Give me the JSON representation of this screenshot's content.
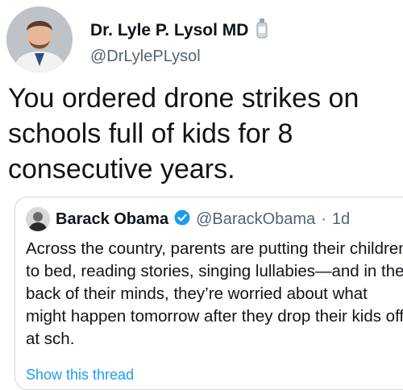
{
  "author": {
    "name": "Dr. Lyle P. Lysol MD",
    "handle": "@DrLylePLysol",
    "badge_icon": "bottle-icon"
  },
  "tweet": {
    "text": "You ordered drone strikes on schools full of kids for 8 consecutive years."
  },
  "quoted_tweet": {
    "name": "Barack Obama",
    "handle": "@BarackObama",
    "separator": "·",
    "time": "1d",
    "verified_icon": "verified-badge-icon",
    "text": "Across the country, parents are putting their children to bed, reading stories, singing lullabies—and in the back of their minds, they’re worried about what might happen tomorrow after they drop their kids off at sch.",
    "show_thread": "Show this thread"
  },
  "colors": {
    "text": "#0f1419",
    "secondary": "#536471",
    "link": "#1d9bf0",
    "verified": "#1d9bf0",
    "border": "#cfd9de"
  }
}
